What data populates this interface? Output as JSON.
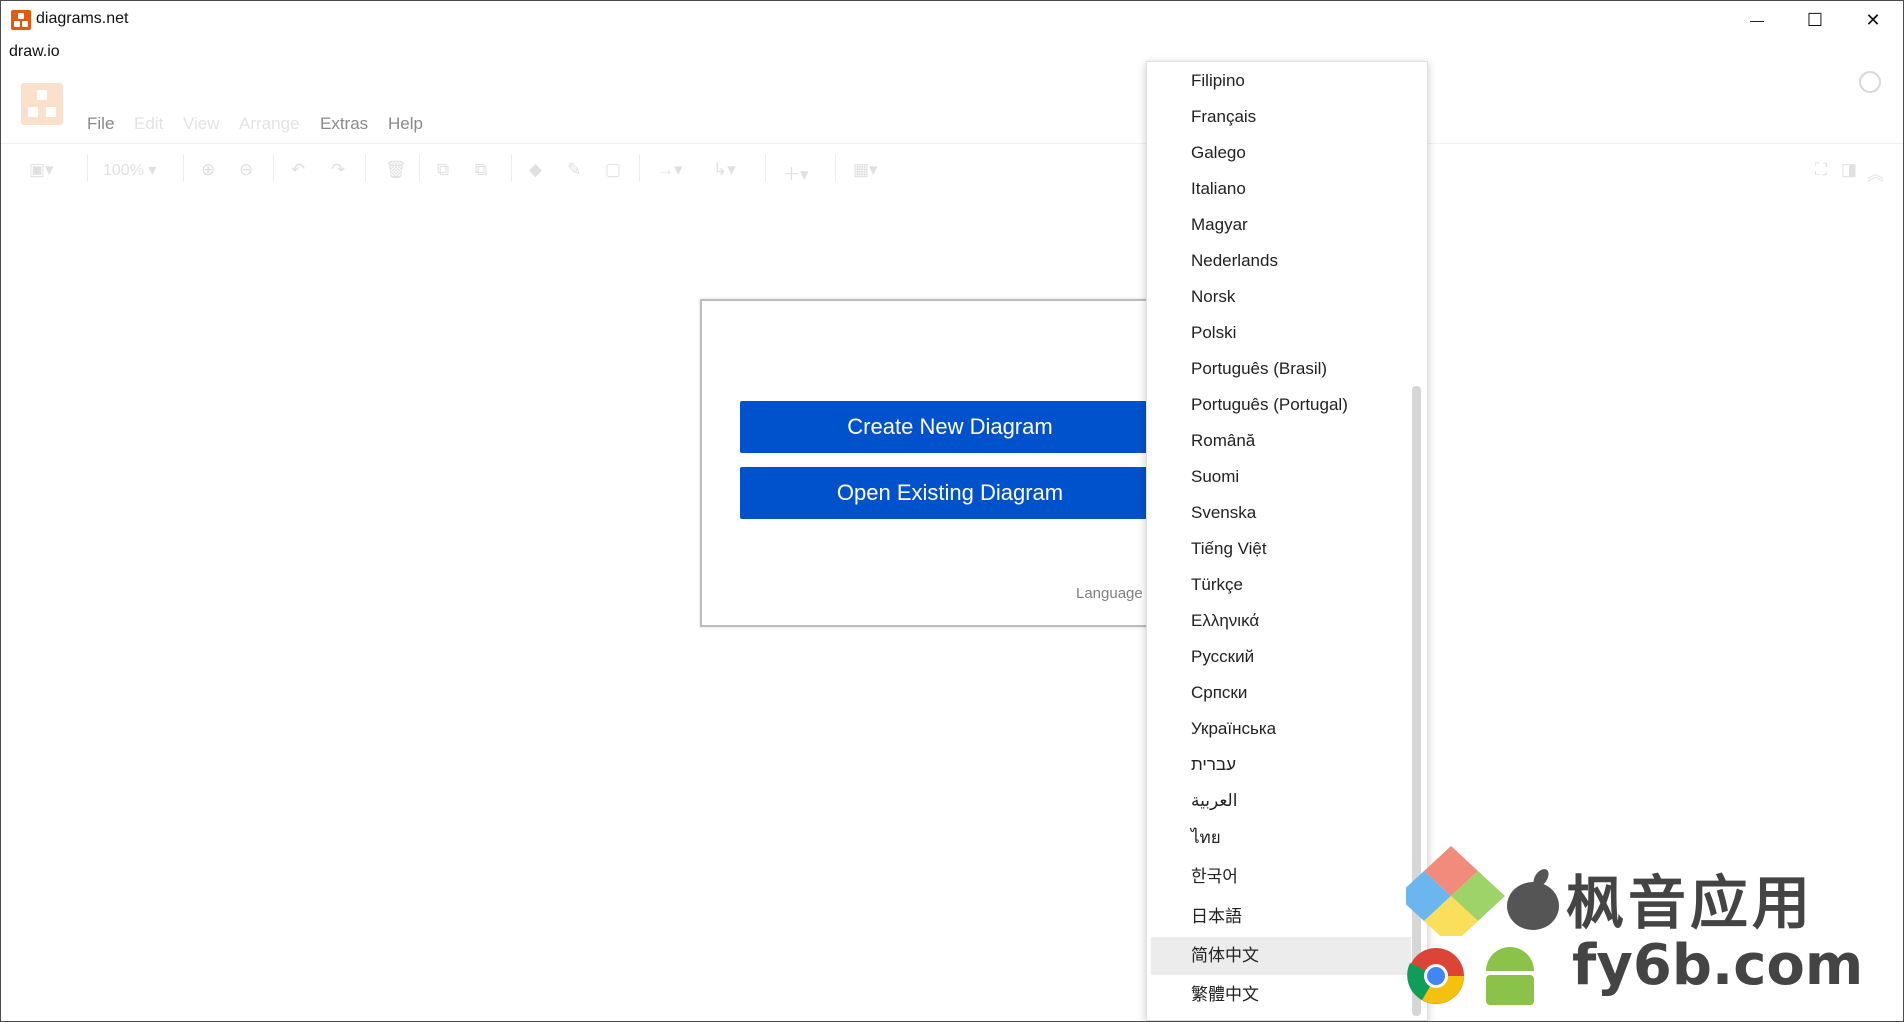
{
  "window": {
    "title": "diagrams.net",
    "subtitle": "draw.io",
    "controls": {
      "minimize": "—",
      "maximize": "☐",
      "close": "✕"
    }
  },
  "menubar": {
    "items": [
      {
        "label": "File",
        "enabled": true
      },
      {
        "label": "Edit",
        "enabled": false
      },
      {
        "label": "View",
        "enabled": false
      },
      {
        "label": "Arrange",
        "enabled": false
      },
      {
        "label": "Extras",
        "enabled": true
      },
      {
        "label": "Help",
        "enabled": true
      }
    ]
  },
  "toolbar": {
    "zoom": "100%",
    "icons": [
      "format-panel-icon",
      "zoom-in-icon",
      "zoom-out-icon",
      "undo-icon",
      "redo-icon",
      "delete-icon",
      "to-front-icon",
      "to-back-icon",
      "fill-color-icon",
      "line-color-icon",
      "shadow-icon",
      "connection-icon",
      "waypoints-icon",
      "insert-icon",
      "table-icon",
      "fullscreen-icon",
      "format-toggle-icon",
      "collapse-icon"
    ]
  },
  "dialog": {
    "create_button": "Create New Diagram",
    "open_button": "Open Existing Diagram",
    "language_label": "Language"
  },
  "language_dropdown": {
    "items": [
      "Filipino",
      "Français",
      "Galego",
      "Italiano",
      "Magyar",
      "Nederlands",
      "Norsk",
      "Polski",
      "Português (Brasil)",
      "Português (Portugal)",
      "Română",
      "Suomi",
      "Svenska",
      "Tiếng Việt",
      "Türkçe",
      "Ελληνικά",
      "Русский",
      "Српски",
      "Українська",
      "עברית",
      "العربية",
      "ไทย",
      "한국어",
      "日本語",
      "简体中文",
      "繁體中文"
    ],
    "selected": "简体中文"
  },
  "watermark": {
    "line1": "枫音应用",
    "line2": "fy6b.com"
  },
  "colors": {
    "accent": "#0052cc",
    "brand": "#e25a0f",
    "selected_bg": "#ececec"
  }
}
